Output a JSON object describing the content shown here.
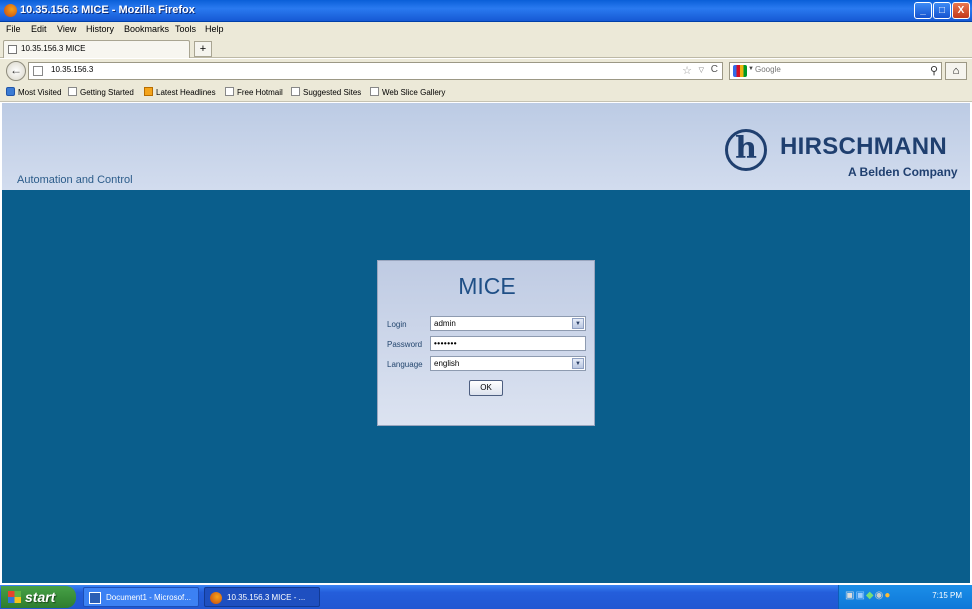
{
  "window": {
    "title": "10.35.156.3 MICE - Mozilla Firefox",
    "buttons": {
      "minimize": "_",
      "maximize": "□",
      "close": "X"
    }
  },
  "menu": [
    "File",
    "Edit",
    "View",
    "History",
    "Bookmarks",
    "Tools",
    "Help"
  ],
  "tab": {
    "label": "10.35.156.3 MICE",
    "new_tab": "+"
  },
  "nav": {
    "back": "←",
    "url": "10.35.156.3",
    "star": "☆",
    "dropdown": "▽",
    "reload": "C",
    "search_placeholder": "Google",
    "search_icon": "⚲",
    "home": "⌂"
  },
  "bookmarks": [
    {
      "label": "Most Visited",
      "icon": "ie-icon"
    },
    {
      "label": "Getting Started",
      "icon": "page-icon"
    },
    {
      "label": "Latest Headlines",
      "icon": "rss-icon"
    },
    {
      "label": "Free Hotmail",
      "icon": "page-icon"
    },
    {
      "label": "Suggested Sites",
      "icon": "page-icon"
    },
    {
      "label": "Web Slice Gallery",
      "icon": "page-icon"
    }
  ],
  "page": {
    "tagline": "Automation and Control",
    "brand": "HIRSCHMANN",
    "brand_mark": "h",
    "brand_sub": "A Belden Company",
    "colors": {
      "header": "#c8d4ea",
      "background": "#0a5e8c",
      "brand": "#1f3f6f"
    }
  },
  "login": {
    "title": "MICE",
    "login_label": "Login",
    "login_value": "admin",
    "password_label": "Password",
    "password_value": "•••••••",
    "language_label": "Language",
    "language_value": "english",
    "ok_label": "OK"
  },
  "taskbar": {
    "start": "start",
    "items": [
      "Document1 - Microsof...",
      "10.35.156.3 MICE - ..."
    ],
    "clock": "7:15 PM"
  }
}
